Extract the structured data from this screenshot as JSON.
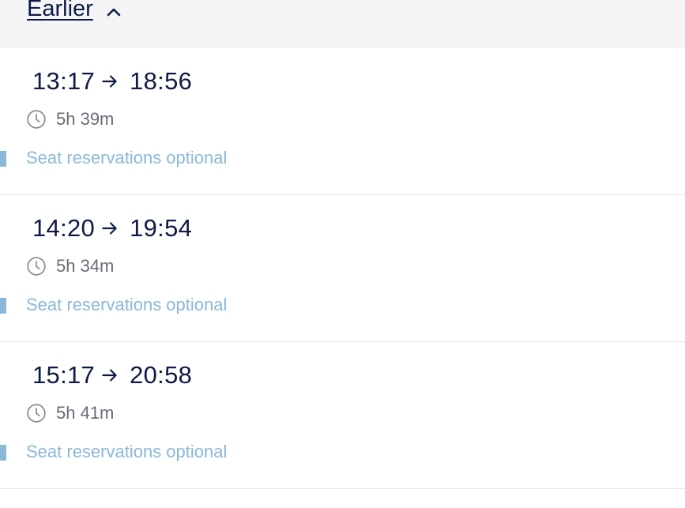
{
  "header": {
    "earlier_label": "Earlier",
    "chevron_icon": "chevron-up-icon"
  },
  "colors": {
    "header_bg": "#f5f5f8",
    "primary_text": "#0e1b46",
    "secondary_text": "#6b6b76",
    "seat_text": "#8ab8d9",
    "divider": "#e6e6eb"
  },
  "journeys": [
    {
      "depart": "13:17",
      "arrive": "18:56",
      "duration": "5h 39m",
      "seat_info": "Seat reservations optional"
    },
    {
      "depart": "14:20",
      "arrive": "19:54",
      "duration": "5h 34m",
      "seat_info": "Seat reservations optional"
    },
    {
      "depart": "15:17",
      "arrive": "20:58",
      "duration": "5h 41m",
      "seat_info": "Seat reservations optional"
    }
  ]
}
